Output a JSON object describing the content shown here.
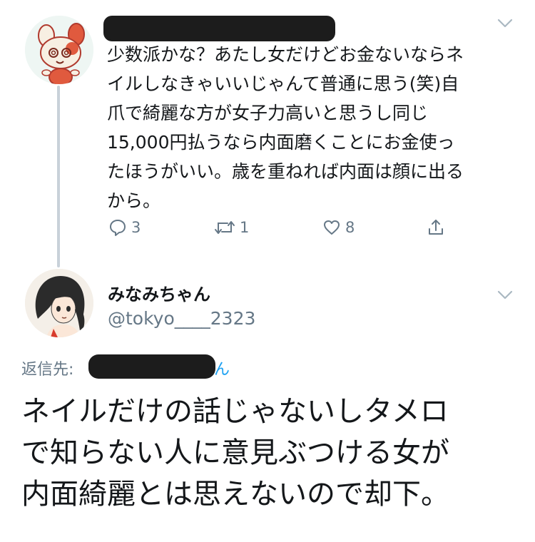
{
  "tweet1": {
    "lines": [
      "少数派かな？あたし女だけどお金ないならネ",
      "イルしなきゃいいじゃんて普通に思う(笑)自",
      "爪で綺麗な方が女子力高いと思うし同じ",
      "15,000円払うなら内面磨くことにお金使っ",
      "たほうがいい。歳を重ねれば内面は顔に出る",
      "から。"
    ],
    "reply_count": "3",
    "retweet_count": "1",
    "like_count": "8"
  },
  "tweet2": {
    "display_name": "みなみちゃん",
    "handle": "@tokyo____2323",
    "reply_to_label": "返信先:",
    "reply_to_tail": "ん",
    "lines": [
      "ネイルだけの話じゃないしタメロ",
      "で知らない人に意見ぶつける女が",
      "内面綺麗とは思えないので却下。"
    ]
  },
  "icons": {
    "reply": "reply-icon",
    "retweet": "retweet-icon",
    "like": "heart-icon",
    "share": "share-icon",
    "more": "chevron-down-icon"
  },
  "colors": {
    "text": "#14171a",
    "secondary": "#657786",
    "link": "#1da1f2",
    "thread_line": "#c8d1d9"
  }
}
